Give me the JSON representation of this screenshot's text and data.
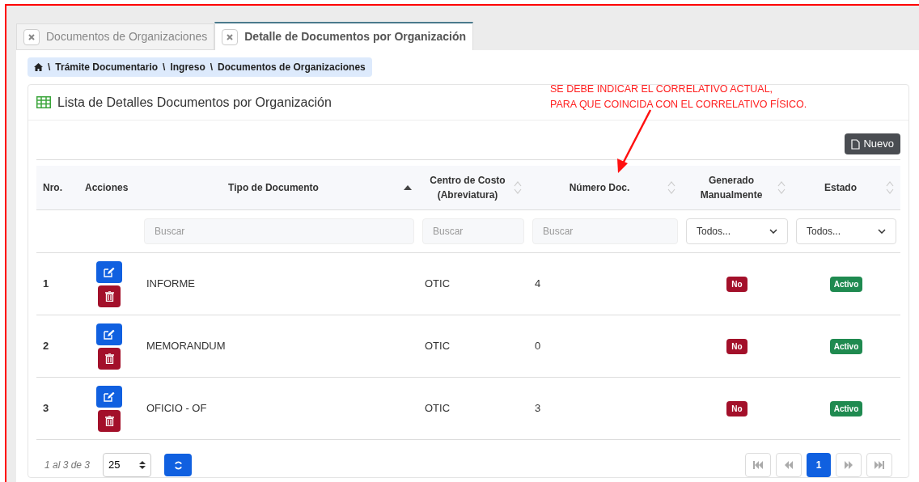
{
  "tabs": [
    {
      "label": "Documentos de Organizaciones",
      "selected": false
    },
    {
      "label": "Detalle de Documentos por Organización",
      "selected": true
    }
  ],
  "breadcrumb": [
    {
      "kind": "separator",
      "text": "\\"
    },
    {
      "kind": "link",
      "text": "Trámite Documentario"
    },
    {
      "kind": "separator",
      "text": "\\"
    },
    {
      "kind": "link",
      "text": "Ingreso"
    },
    {
      "kind": "separator",
      "text": "\\"
    },
    {
      "kind": "link",
      "text": "Documentos de Organizaciones"
    }
  ],
  "card": {
    "title": "Lista de Detalles Documentos por Organización",
    "new_button": "Nuevo"
  },
  "annotation": {
    "lines": [
      "SE DEBE INDICAR EL CORRELATIVO ACTUAL,",
      "PARA QUE COINCIDA CON EL CORRELATIVO FÍSICO."
    ]
  },
  "table": {
    "columns": [
      {
        "label": "Nro."
      },
      {
        "label": "Acciones"
      },
      {
        "label": "Tipo de Documento",
        "sorted": true,
        "filter": {
          "kind": "text",
          "placeholder": "Buscar"
        }
      },
      {
        "label": "Centro de Costo (Abreviatura)",
        "sorted": false,
        "filter": {
          "kind": "text",
          "placeholder": "Buscar"
        }
      },
      {
        "label": "Número Doc.",
        "sorted": false,
        "filter": {
          "kind": "text",
          "placeholder": "Buscar"
        }
      },
      {
        "label": "Generado Manualmente",
        "sorted": false,
        "filter": {
          "kind": "select",
          "value": "Todos..."
        }
      },
      {
        "label": "Estado",
        "sorted": false,
        "filter": {
          "kind": "select",
          "value": "Todos..."
        }
      }
    ],
    "rows": [
      {
        "nro": "1",
        "tipo": "INFORME",
        "centro": "OTIC",
        "numero": "4",
        "generado": "No",
        "estado": "Activo"
      },
      {
        "nro": "2",
        "tipo": "MEMORANDUM",
        "centro": "OTIC",
        "numero": "0",
        "generado": "No",
        "estado": "Activo"
      },
      {
        "nro": "3",
        "tipo": "OFICIO - OF",
        "centro": "OTIC",
        "numero": "3",
        "generado": "No",
        "estado": "Activo"
      }
    ]
  },
  "footer": {
    "summary": "1 al 3 de 3",
    "page_size": "25",
    "pages": [
      {
        "label": "1",
        "selected": true
      }
    ]
  }
}
